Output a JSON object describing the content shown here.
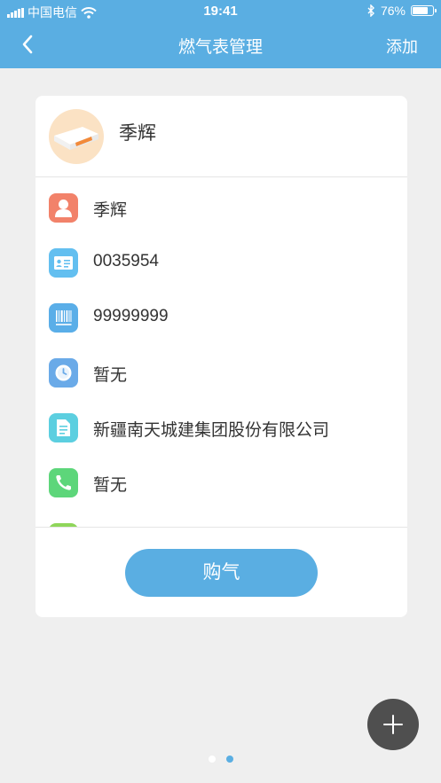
{
  "status_bar": {
    "carrier": "中国电信",
    "time": "19:41",
    "battery_percent": "76%",
    "battery_level": 0.76,
    "icons": [
      "signal-icon",
      "wifi-icon",
      "bluetooth-icon",
      "battery-icon"
    ]
  },
  "nav": {
    "back_icon": "chevron-left-icon",
    "title": "燃气表管理",
    "add_label": "添加"
  },
  "card": {
    "name": "季辉",
    "rows": [
      {
        "icon": "user-icon",
        "color": "#f2826a",
        "text": "季辉"
      },
      {
        "icon": "id-card-icon",
        "color": "#63bff0",
        "text": "0035954"
      },
      {
        "icon": "barcode-icon",
        "color": "#5aaee8",
        "text": "99999999"
      },
      {
        "icon": "clock-icon",
        "color": "#6aaae8",
        "text": "暂无"
      },
      {
        "icon": "document-icon",
        "color": "#5ccfe0",
        "text": "新疆南天城建集团股份有限公司"
      },
      {
        "icon": "phone-icon",
        "color": "#5dd67a",
        "text": "暂无"
      },
      {
        "icon": "location-icon",
        "color": "#8fd65a",
        "text": ""
      }
    ],
    "buy_label": "购气"
  },
  "fab": {
    "icon": "plus-icon"
  },
  "pager": {
    "count": 2,
    "active": 1
  },
  "colors": {
    "primary": "#5aaee2",
    "background": "#efefef",
    "fab": "#4f4f4f"
  }
}
